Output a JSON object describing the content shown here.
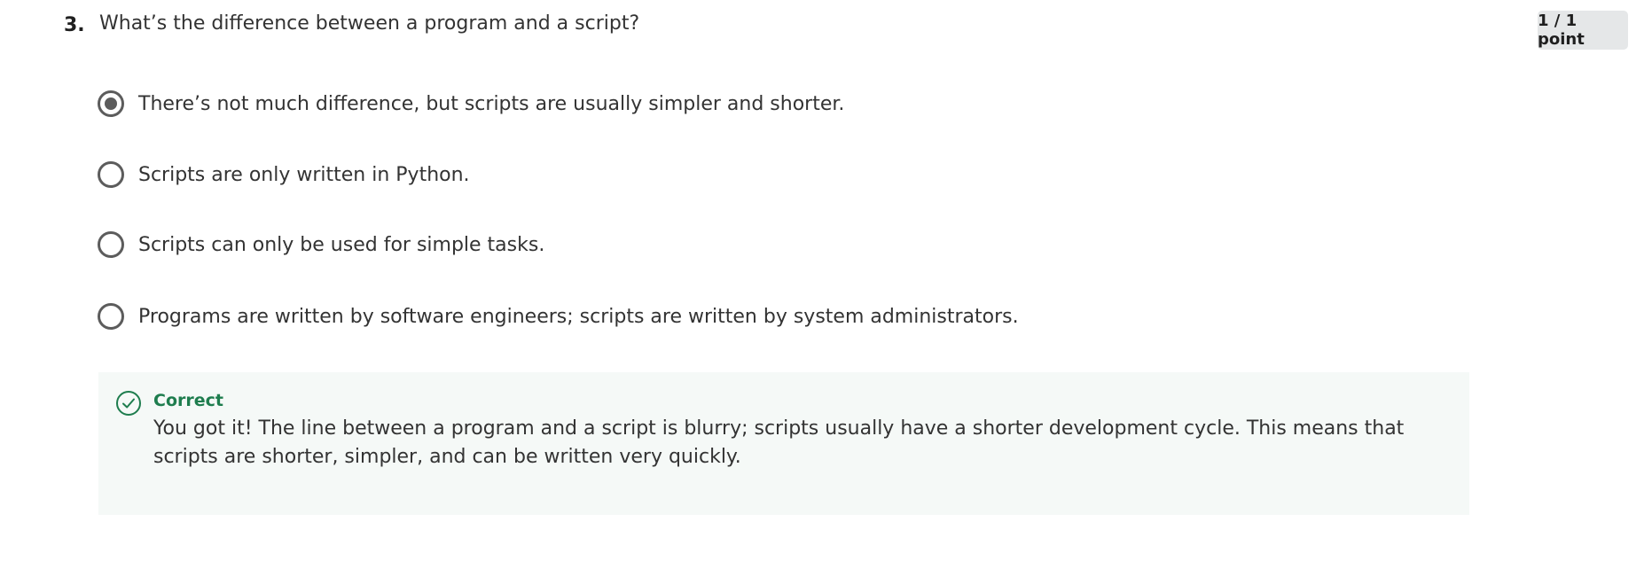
{
  "question": {
    "number": "3.",
    "text": "What’s the difference between a program and a script?",
    "score": "1 / 1 point"
  },
  "options": [
    {
      "label": "There’s not much difference, but scripts are usually simpler and shorter.",
      "selected": true
    },
    {
      "label": "Scripts are only written in Python.",
      "selected": false
    },
    {
      "label": "Scripts can only be used for simple tasks.",
      "selected": false
    },
    {
      "label": "Programs are written by software engineers; scripts are written by system administrators.",
      "selected": false
    }
  ],
  "feedback": {
    "icon": "check-circle-icon",
    "title": "Correct",
    "text": "You got it! The line between a program and a script is blurry; scripts usually have a shorter development cycle. This means that scripts are shorter, simpler, and can be written very quickly."
  },
  "colors": {
    "correct_green": "#1e7d4e",
    "feedback_bg": "#f5f9f7",
    "radio_gray": "#5c5c5c",
    "badge_bg": "#e5e7e8"
  }
}
